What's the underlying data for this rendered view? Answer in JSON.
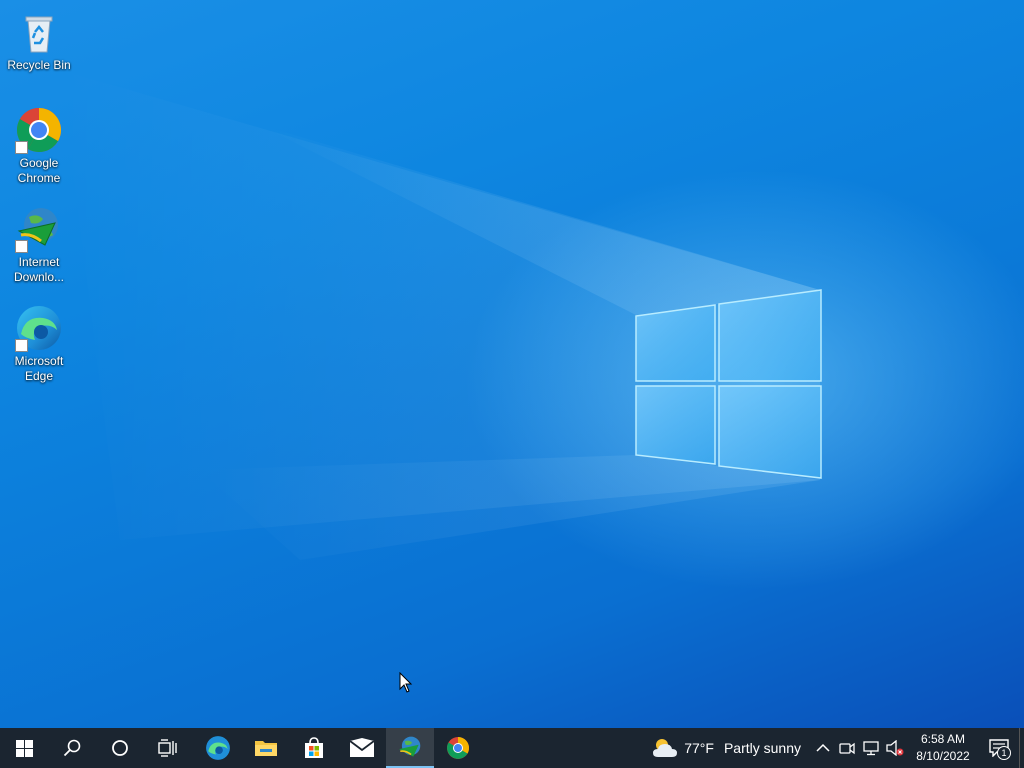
{
  "desktop": {
    "icons": [
      {
        "label": "Recycle Bin",
        "icon": "recycle-bin-icon"
      },
      {
        "label": "Google\nChrome",
        "icon": "chrome-icon"
      },
      {
        "label": "Internet\nDownlo...",
        "icon": "internet-download-manager-icon"
      },
      {
        "label": "Microsoft\nEdge",
        "icon": "edge-icon"
      }
    ]
  },
  "taskbar": {
    "buttons": [
      {
        "name": "start-button",
        "icon": "windows-logo-icon"
      },
      {
        "name": "search-button",
        "icon": "search-icon"
      },
      {
        "name": "cortana-button",
        "icon": "cortana-icon"
      },
      {
        "name": "task-view-button",
        "icon": "task-view-icon"
      },
      {
        "name": "taskbar-edge",
        "icon": "edge-icon"
      },
      {
        "name": "taskbar-file-explorer",
        "icon": "folder-icon"
      },
      {
        "name": "taskbar-store",
        "icon": "store-icon"
      },
      {
        "name": "taskbar-mail",
        "icon": "mail-icon"
      },
      {
        "name": "taskbar-idm",
        "icon": "internet-download-manager-icon",
        "active": true
      },
      {
        "name": "taskbar-chrome",
        "icon": "chrome-icon"
      }
    ],
    "weather": {
      "temp": "77°F",
      "condition": "Partly sunny",
      "icon": "partly-sunny-icon"
    },
    "tray_icons": [
      "chevron-up-icon",
      "meet-now-icon",
      "network-icon",
      "volume-muted-icon"
    ],
    "clock": {
      "time": "6:58 AM",
      "date": "8/10/2022"
    },
    "notifications": {
      "count": "1",
      "icon": "action-center-icon"
    }
  },
  "colors": {
    "wallpaper_accent": "#0a78d4",
    "taskbar_bg": "#1b2530",
    "active_indicator": "#7cc3f4"
  }
}
